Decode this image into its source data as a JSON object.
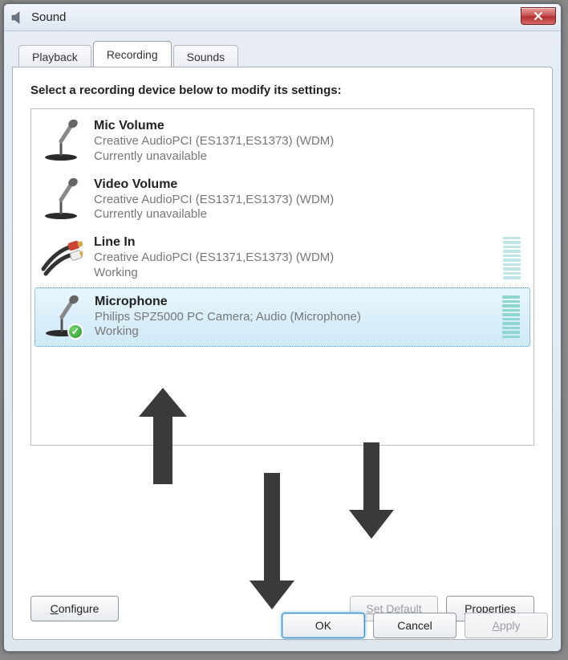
{
  "window": {
    "title": "Sound"
  },
  "tabs": {
    "playback": "Playback",
    "recording": "Recording",
    "sounds": "Sounds",
    "active": "recording"
  },
  "instruction": "Select a recording device below to modify its settings:",
  "devices": [
    {
      "name": "Mic Volume",
      "desc": "Creative AudioPCI (ES1371,ES1373) (WDM)",
      "status": "Currently unavailable"
    },
    {
      "name": "Video Volume",
      "desc": "Creative AudioPCI (ES1371,ES1373) (WDM)",
      "status": "Currently unavailable"
    },
    {
      "name": "Line In",
      "desc": "Creative AudioPCI (ES1371,ES1373) (WDM)",
      "status": "Working"
    },
    {
      "name": "Microphone",
      "desc": "Philips SPZ5000 PC Camera; Audio (Microphone)",
      "status": "Working"
    }
  ],
  "buttons": {
    "configure": "Configure",
    "set_default": "Set Default",
    "properties": "Properties",
    "ok": "OK",
    "cancel": "Cancel",
    "apply": "Apply"
  }
}
